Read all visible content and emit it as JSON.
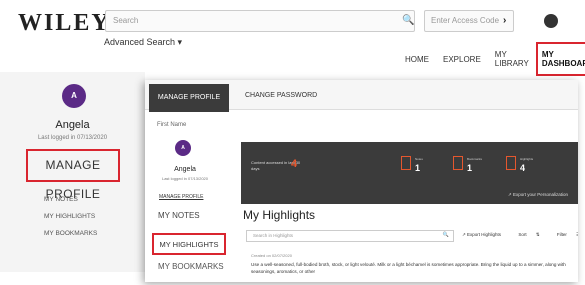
{
  "header": {
    "logo": "WILEY",
    "search_placeholder": "Search",
    "access_code_placeholder": "Enter Access Code",
    "advanced_search": "Advanced Search ▾"
  },
  "nav": {
    "items": [
      "HOME",
      "EXPLORE",
      "MY LIBRARY",
      "MY DASHBOARD"
    ],
    "active": "MY DASHBOARD"
  },
  "bg_sidebar": {
    "avatar_letter": "A",
    "name": "Angela",
    "last_logged": "Last logged in 07/13/2020",
    "manage_profile": "MANAGE PROFILE",
    "menu": [
      "MY NOTES",
      "MY HIGHLIGHTS",
      "MY BOOKMARKS"
    ]
  },
  "overlay": {
    "tabs": {
      "active": "MANAGE PROFILE",
      "other": "CHANGE PASSWORD"
    },
    "first_name_label": "First Name",
    "sidebar": {
      "avatar_letter": "A",
      "name": "Angela",
      "last_logged": "Last logged in 07/13/2020",
      "manage_profile": "MANAGE PROFILE",
      "notes": "MY NOTES",
      "highlights": "MY HIGHLIGHTS",
      "bookmarks": "MY BOOKMARKS"
    },
    "stats": {
      "content_label": "Content accessed in last 30 days",
      "content_count": "4",
      "notes_label": "Notes",
      "notes_count": "1",
      "bookmarks_label": "Bookmarks",
      "bookmarks_count": "1",
      "highlights_label": "Highlights",
      "highlights_count": "4",
      "export_label": "Export your Personalization"
    },
    "highlights_section": {
      "title": "My Highlights",
      "search_placeholder": "Search in Highlights",
      "export_label": "Export Highlights",
      "sort_label": "Sort",
      "filter_label": "Filter",
      "entry_date": "Created on 02/07/2020",
      "entry_text": "Use a well-seasoned, full-bodied broth, stock, or light velouté. Milk or a light béchamel is sometimes appropriate. Bring the liquid up to a simmer, along with seasonings, aromatics, or other"
    }
  },
  "colors": {
    "accent": "#d9252f",
    "stat_orange": "#e5572e",
    "avatar_purple": "#5b2a86",
    "dark_bar": "#3b3b3b"
  }
}
